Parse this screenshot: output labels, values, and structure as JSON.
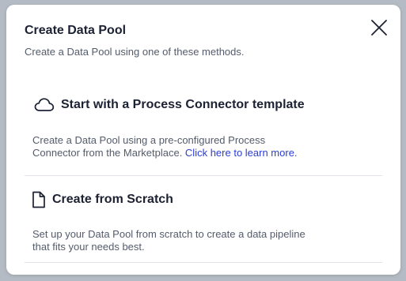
{
  "modal": {
    "title": "Create Data Pool",
    "subtitle": "Create a Data Pool using one of these methods."
  },
  "options": [
    {
      "icon": "cloud-icon",
      "title": "Start with a Process Connector template",
      "description": "Create a Data Pool using a pre-configured Process Connector from the Marketplace. ",
      "link_text": "Click here to learn more."
    },
    {
      "icon": "document-icon",
      "title": "Create from Scratch",
      "description": "Set up your Data Pool from scratch to create a data pipeline that fits your needs best."
    }
  ],
  "colors": {
    "heading": "#1c2133",
    "body_text": "#545b6b",
    "link": "#2a3dd6",
    "divider": "#e1e4e8"
  }
}
